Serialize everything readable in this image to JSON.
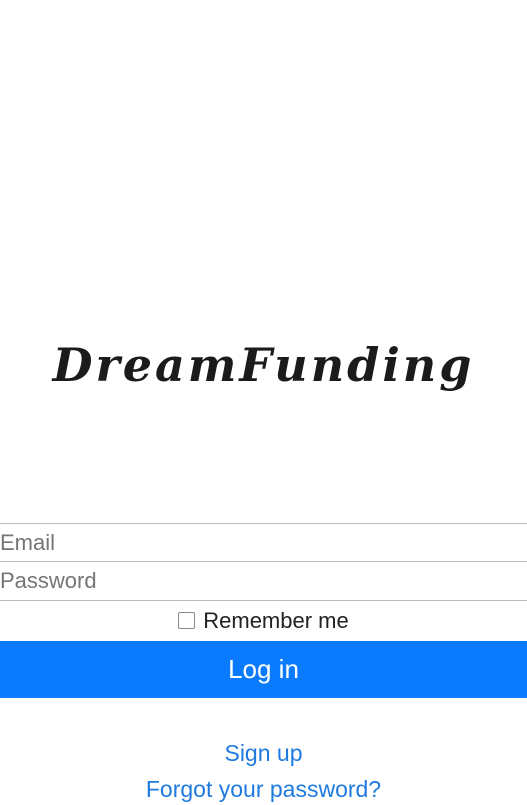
{
  "app": {
    "logo_text": "DreamFunding"
  },
  "form": {
    "email_placeholder": "Email",
    "email_value": "",
    "password_placeholder": "Password",
    "password_value": "",
    "remember_label": "Remember me",
    "remember_checked": false,
    "login_label": "Log in"
  },
  "links": {
    "signup": "Sign up",
    "forgot_password": "Forgot your password?"
  },
  "colors": {
    "primary_button": "#0a7bff",
    "link": "#1f7ae0"
  }
}
